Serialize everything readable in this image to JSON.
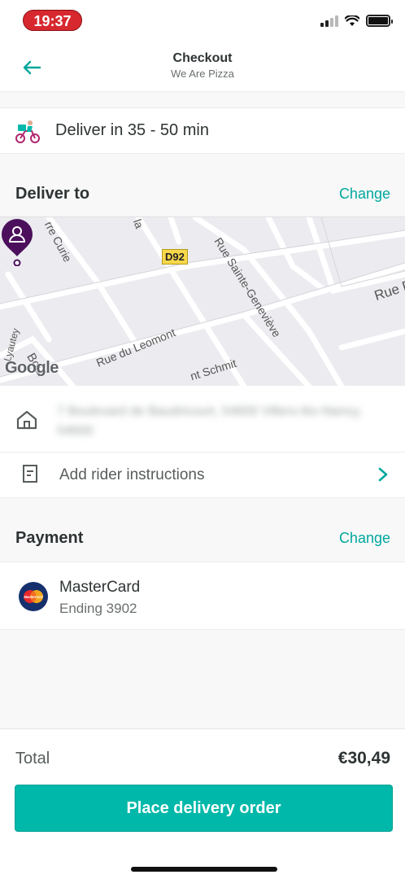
{
  "status_bar": {
    "time": "19:37"
  },
  "header": {
    "title": "Checkout",
    "subtitle": "We Are Pizza"
  },
  "delivery": {
    "time_text": "Deliver in 35 - 50 min"
  },
  "deliver_to": {
    "title": "Deliver to",
    "change_label": "Change",
    "map": {
      "road_badge": "D92",
      "streets": [
        "rre Curie",
        "Rue Sainte-Geneviève",
        "Rue du Leomont",
        "nt Schmit",
        "Rue F",
        "la",
        "Lyautey",
        "Boul"
      ],
      "attribution": "Google"
    },
    "address_blurred": "7 Boulevard de Baudricourt, 54600 Villers-lès-Nancy, 54600",
    "instructions_label": "Add rider instructions"
  },
  "payment": {
    "title": "Payment",
    "change_label": "Change",
    "card_name": "MasterCard",
    "card_sub": "Ending 3902",
    "card_logo_text": "MasterCard"
  },
  "footer": {
    "total_label": "Total",
    "total_value": "€30,49",
    "cta_label": "Place delivery order"
  },
  "colors": {
    "accent": "#00b8a9",
    "link": "#00a89c",
    "pin": "#4b0f5c",
    "status_pill": "#d7282f"
  }
}
